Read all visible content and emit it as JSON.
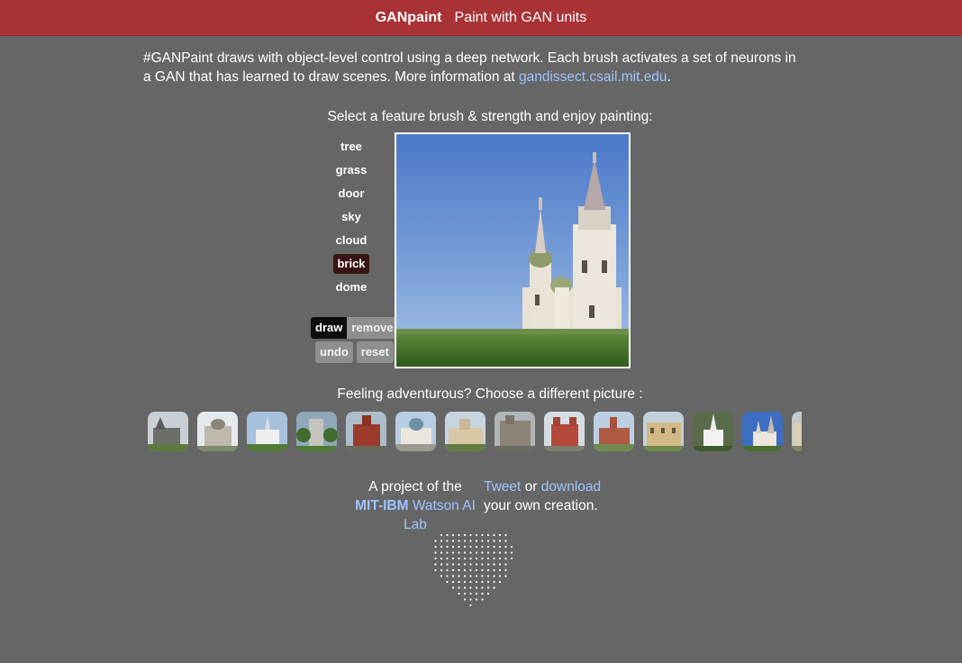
{
  "header": {
    "brand": "GANpaint",
    "tagline": "Paint with GAN units"
  },
  "intro": {
    "text": "#GANPaint draws with object-level control using a deep network. Each brush activates a set of neurons in a GAN that has learned to draw scenes. More information at ",
    "link": "gandissect.csail.mit.edu",
    "trailing": "."
  },
  "painter": {
    "title": "Select a feature brush & strength and enjoy painting:",
    "brushes": [
      "tree",
      "grass",
      "door",
      "sky",
      "cloud",
      "brick",
      "dome"
    ],
    "active_brush": "brick",
    "modes": {
      "draw": "draw",
      "remove": "remove",
      "active": "draw"
    },
    "actions": {
      "undo": "undo",
      "reset": "reset"
    }
  },
  "gallery": {
    "title": "Feeling adventurous? Choose a different picture :",
    "thumb_count": 14
  },
  "footer": {
    "project_prefix": "A project of the",
    "lab_bold": "MIT-IBM",
    "lab_rest": " Watson AI Lab",
    "tweet": "Tweet",
    "or": " or ",
    "download": "download",
    "creation": "your own creation."
  },
  "colors": {
    "header_bg": "#a83236",
    "page_bg": "#666666",
    "link": "#9ec3ff",
    "active_brush_bg": "#3a1414"
  },
  "icons": {
    "heart": "dotted-heart-icon"
  }
}
